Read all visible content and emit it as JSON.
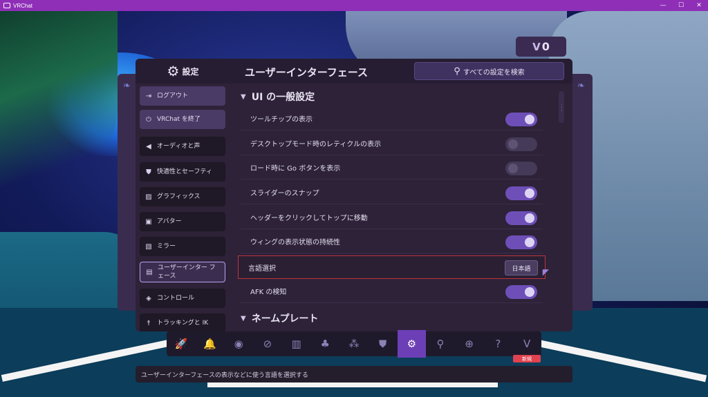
{
  "window": {
    "title": "VRChat",
    "minimize": "—",
    "maximize": "☐",
    "close": "✕"
  },
  "currency": {
    "icon": "V",
    "amount": "0"
  },
  "header": {
    "settings_label": "設定",
    "page_title": "ユーザーインターフェース",
    "search_label": "すべての設定を検索"
  },
  "sidebar": {
    "items": [
      {
        "label": "ログアウト",
        "icon": "logout-icon"
      },
      {
        "label": "VRChat を終了",
        "icon": "power-icon"
      },
      {
        "label": "オーディオと声",
        "icon": "speaker-icon"
      },
      {
        "label": "快適性とセーフティ",
        "icon": "shield-icon"
      },
      {
        "label": "グラフィックス",
        "icon": "image-icon"
      },
      {
        "label": "アバター",
        "icon": "avatar-icon"
      },
      {
        "label": "ミラー",
        "icon": "mirror-icon"
      },
      {
        "label": "ユーザーインター フェース",
        "icon": "ui-icon"
      },
      {
        "label": "コントロール",
        "icon": "gamepad-icon"
      },
      {
        "label": "トラッキングと IK",
        "icon": "figure-icon"
      }
    ]
  },
  "content": {
    "section1": "UI の一般設定",
    "rows": [
      {
        "label": "ツールチップの表示",
        "state": "on"
      },
      {
        "label": "デスクトップモード時のレティクルの表示",
        "state": "off"
      },
      {
        "label": "ロード時に Go ボタンを表示",
        "state": "off"
      },
      {
        "label": "スライダーのスナップ",
        "state": "on"
      },
      {
        "label": "ヘッダーをクリックしてトップに移動",
        "state": "on"
      },
      {
        "label": "ウィングの表示状態の持続性",
        "state": "on"
      },
      {
        "label": "言語選択",
        "value": "日本語"
      },
      {
        "label": "AFK の検知",
        "state": "on"
      }
    ],
    "section2": "ネームプレート"
  },
  "dock": {
    "items": [
      {
        "icon": "rocket-icon",
        "glyph": "🚀"
      },
      {
        "icon": "bell-icon",
        "glyph": "🔔"
      },
      {
        "icon": "profile-icon",
        "glyph": "◉"
      },
      {
        "icon": "compass-icon",
        "glyph": "⊘"
      },
      {
        "icon": "avatar-book-icon",
        "glyph": "▥"
      },
      {
        "icon": "group-icon",
        "glyph": "♣"
      },
      {
        "icon": "network-icon",
        "glyph": "⁂"
      },
      {
        "icon": "safety-shield-icon",
        "glyph": "⛊"
      },
      {
        "icon": "settings-gear-icon",
        "glyph": "⚙"
      },
      {
        "icon": "search-icon",
        "glyph": "⚲"
      },
      {
        "icon": "add-icon",
        "glyph": "⊕"
      },
      {
        "icon": "help-icon",
        "glyph": "?"
      },
      {
        "icon": "vrchat-plus-icon",
        "glyph": "V"
      }
    ],
    "active_index": 8,
    "new_badge": "新規"
  },
  "tooltip": "ユーザーインターフェースの表示などに使う言語を選択する"
}
